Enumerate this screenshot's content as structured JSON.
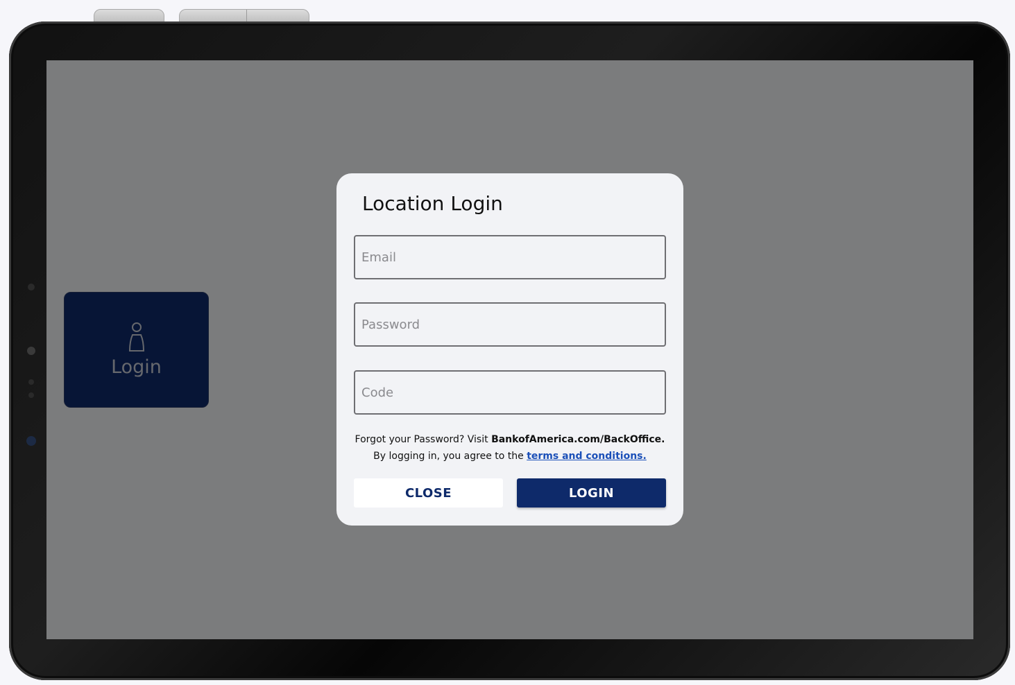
{
  "tile": {
    "icon": "person-icon",
    "label": "Login"
  },
  "dialog": {
    "title": "Location Login",
    "email_placeholder": "Email",
    "password_placeholder": "Password",
    "code_placeholder": "Code",
    "forgot_prefix": "Forgot your Password? Visit ",
    "forgot_link": "BankofAmerica.com/BackOffice.",
    "terms_prefix": "By logging in, you agree to the ",
    "terms_link": "terms and conditions.",
    "close_label": "CLOSE",
    "login_label": "LOGIN"
  },
  "colors": {
    "brand_navy": "#0e2a6a",
    "link_blue": "#1a4fb8",
    "dialog_bg": "#f2f3f6"
  }
}
